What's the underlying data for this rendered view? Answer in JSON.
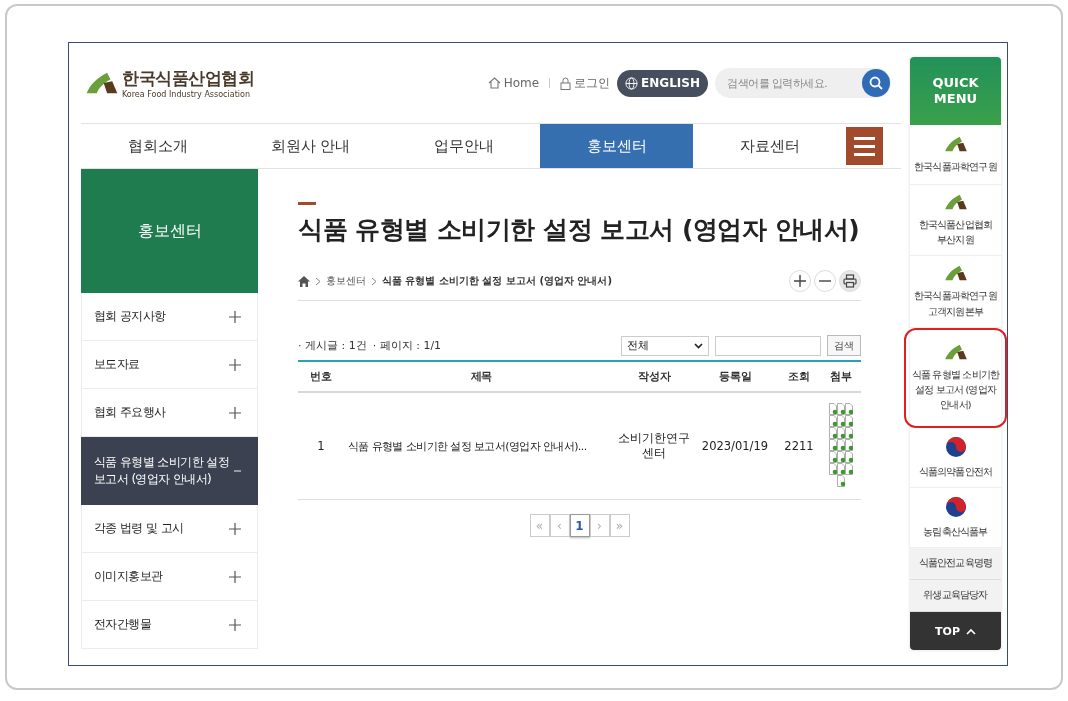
{
  "header": {
    "logo": {
      "name": "한국식품산업협회",
      "subtitle": "Korea Food Industry Association"
    },
    "links": [
      {
        "kind": "home",
        "label": "Home"
      },
      {
        "kind": "lock",
        "label": "로그인"
      }
    ],
    "language_button": "ENGLISH",
    "search": {
      "placeholder": "검색어를 입력하세요."
    }
  },
  "nav": [
    {
      "label": "협회소개",
      "selected": false
    },
    {
      "label": "회원사 안내",
      "selected": false
    },
    {
      "label": "업무안내",
      "selected": false
    },
    {
      "label": "홍보센터",
      "selected": true
    },
    {
      "label": "자료센터",
      "selected": false
    }
  ],
  "sidebar": {
    "title": "홍보센터",
    "items": [
      {
        "label": "협회 공지사항",
        "selected": false
      },
      {
        "label": "보도자료",
        "selected": false
      },
      {
        "label": "협회 주요행사",
        "selected": false
      },
      {
        "label": "식품 유형별 소비기한 설정 보고서 (영업자 안내서)",
        "selected": true
      },
      {
        "label": "각종 법령 및 고시",
        "selected": false
      },
      {
        "label": "이미지홍보관",
        "selected": false
      },
      {
        "label": "전자간행물",
        "selected": false
      }
    ]
  },
  "content": {
    "title": "식품 유형별 소비기한 설정 보고서 (영업자 안내서)",
    "breadcrumb": [
      "홍보센터",
      "식품 유형별 소비기한 설정 보고서 (영업자 안내서)"
    ],
    "count": "· 게시글 : 1건",
    "page_info": "· 페이지 : 1/1",
    "filter": {
      "value": "전체"
    },
    "search_button": "검색",
    "table": {
      "columns": [
        "번호",
        "제목",
        "작성자",
        "등록일",
        "조회",
        "첨부"
      ],
      "rows": [
        {
          "cells": [
            "1",
            "식품 유형별 소비기한 설정 보고서(영업자 안내서)...",
            "소비기한연구센터",
            "2023/01/19",
            "2211"
          ]
        }
      ]
    },
    "pagination": {
      "first": "«",
      "prev": "‹",
      "pages": [
        {
          "label": "1",
          "selected": true
        }
      ],
      "next": "›",
      "last": "»"
    }
  },
  "quick_menu": {
    "title": "QUICK MENU",
    "items": [
      {
        "kind": "logo",
        "label": "한국식품과학연구원",
        "highlighted": false
      },
      {
        "kind": "logo",
        "label": "한국식품산업협회 부산지원",
        "highlighted": false
      },
      {
        "kind": "logo",
        "label": "한국식품과학연구원 고객지원본부",
        "highlighted": false
      },
      {
        "kind": "logo",
        "label": "식품 유형별 소비기한 설정 보고서 (영업자 안내서)",
        "highlighted": true
      },
      {
        "kind": "emblem",
        "label": "식품의약품안전처",
        "highlighted": false
      },
      {
        "kind": "emblem",
        "label": "농림축산식품부",
        "highlighted": false
      },
      {
        "kind": "text",
        "label": "식품안전교육명령",
        "highlighted": false
      },
      {
        "kind": "text",
        "label": "위생교육담당자",
        "highlighted": false
      }
    ],
    "top_button": "TOP"
  }
}
